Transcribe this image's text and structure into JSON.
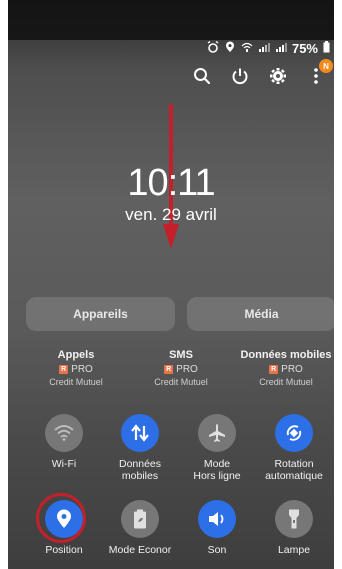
{
  "status_bar": {
    "battery": "75%",
    "icons": [
      "alarm-icon",
      "location-icon",
      "wifi-calling-icon",
      "signal-icon",
      "signal-icon",
      "battery-icon"
    ]
  },
  "quick_actions": {
    "icons": [
      "search-icon",
      "power-icon",
      "settings-icon",
      "more-icon"
    ],
    "notification_badge": "N"
  },
  "lockscreen": {
    "time": "10:11",
    "date": "ven. 29 avril"
  },
  "buttons": {
    "devices": "Appareils",
    "media": "Média"
  },
  "sim_cards": [
    {
      "title": "Appels",
      "badge": "R",
      "plan": "PRO",
      "carrier": "Credit Mutuel"
    },
    {
      "title": "SMS",
      "badge": "R",
      "plan": "PRO",
      "carrier": "Credit Mutuel"
    },
    {
      "title": "Données mobiles",
      "badge": "R",
      "plan": "PRO",
      "carrier": "Credit Mutuel"
    }
  ],
  "tiles": [
    {
      "label_1": "Wi-Fi",
      "label_2": "",
      "icon": "wifi-icon",
      "state": "off"
    },
    {
      "label_1": "Données",
      "label_2": "mobiles",
      "icon": "data-arrows-icon",
      "state": "on"
    },
    {
      "label_1": "Mode",
      "label_2": "Hors ligne",
      "icon": "airplane-icon",
      "state": "off"
    },
    {
      "label_1": "Rotation",
      "label_2": "automatique",
      "icon": "rotation-icon",
      "state": "on"
    },
    {
      "label_1": "Position",
      "label_2": "",
      "icon": "location-icon",
      "state": "on"
    },
    {
      "label_1": "Mode Econor",
      "label_2": "",
      "icon": "battery-saver-icon",
      "state": "off"
    },
    {
      "label_1": "Son",
      "label_2": "",
      "icon": "speaker-icon",
      "state": "on"
    },
    {
      "label_1": "Lampe",
      "label_2": "",
      "icon": "flashlight-icon",
      "state": "off"
    }
  ],
  "colors": {
    "accent": "#2d6fe6",
    "annotation": "#c4202a",
    "badge": "#f28a1c"
  }
}
